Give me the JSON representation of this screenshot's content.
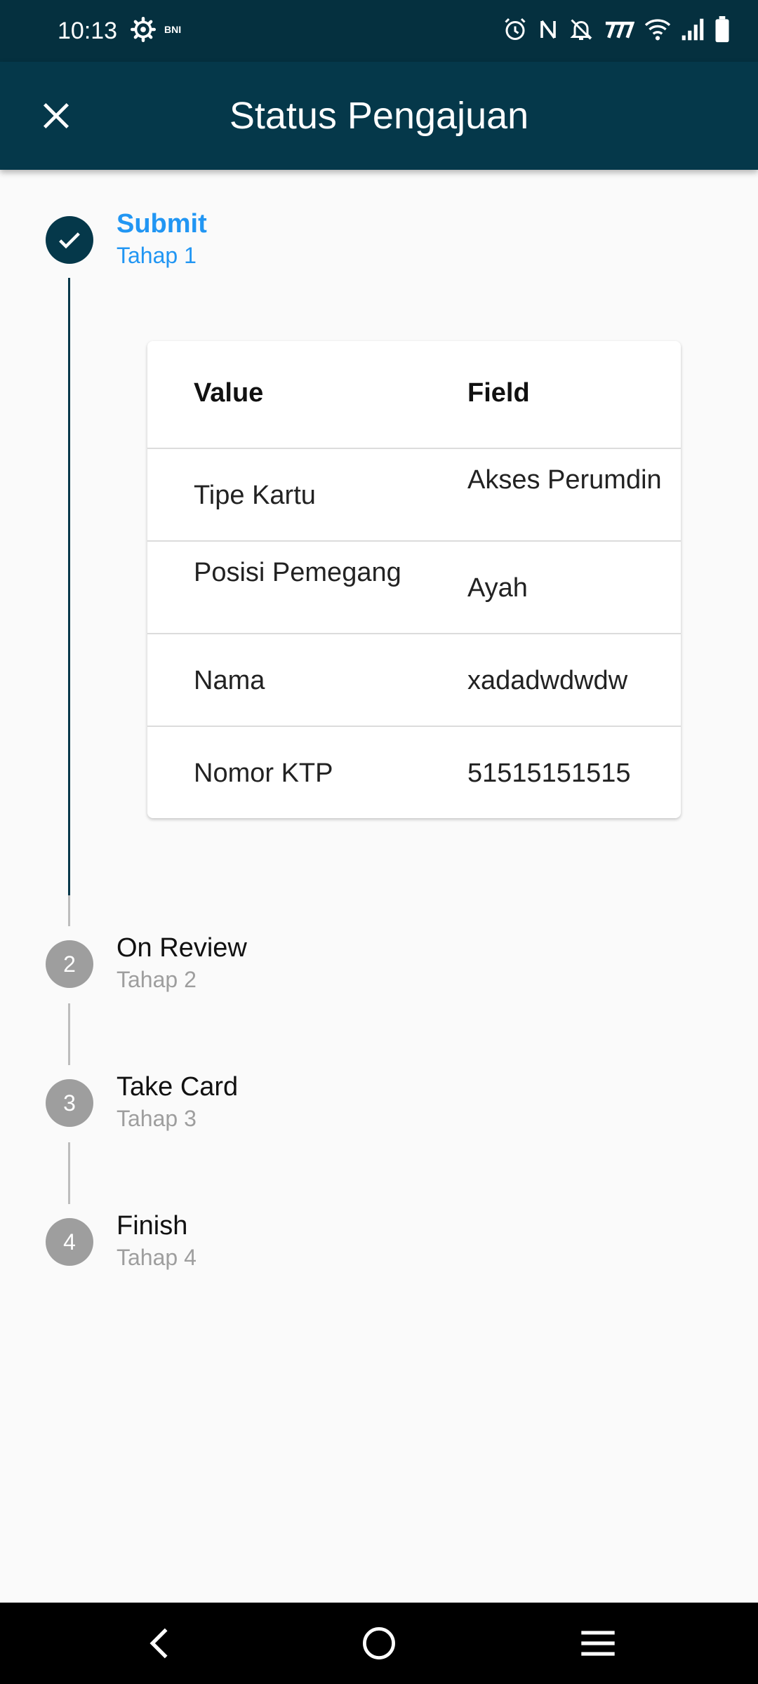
{
  "status_bar": {
    "time": "10:13",
    "bni": "BNI"
  },
  "header": {
    "title": "Status Pengajuan"
  },
  "steps": [
    {
      "title": "Submit",
      "subtitle": "Tahap 1",
      "state": "done"
    },
    {
      "number": "2",
      "title": "On Review",
      "subtitle": "Tahap 2",
      "state": "todo"
    },
    {
      "number": "3",
      "title": "Take Card",
      "subtitle": "Tahap 3",
      "state": "todo"
    },
    {
      "number": "4",
      "title": "Finish",
      "subtitle": "Tahap 4",
      "state": "todo"
    }
  ],
  "table": {
    "headers": [
      "Value",
      "Field"
    ],
    "rows": [
      [
        "Tipe Kartu",
        "Akses Perumdin"
      ],
      [
        "Posisi Pemegang",
        "Ayah"
      ],
      [
        "Nama",
        "xadadwdwdw"
      ],
      [
        "Nomor KTP",
        "51515151515"
      ]
    ]
  },
  "colors": {
    "app_bar": "#05384a",
    "status_bar": "#05303f",
    "active_step_text": "#2196f3",
    "inactive_step_circle": "#9e9e9e"
  },
  "icons": {
    "close": "close-icon",
    "done": "check-icon",
    "back": "back-icon",
    "home": "home-icon",
    "recents": "menu-icon"
  }
}
